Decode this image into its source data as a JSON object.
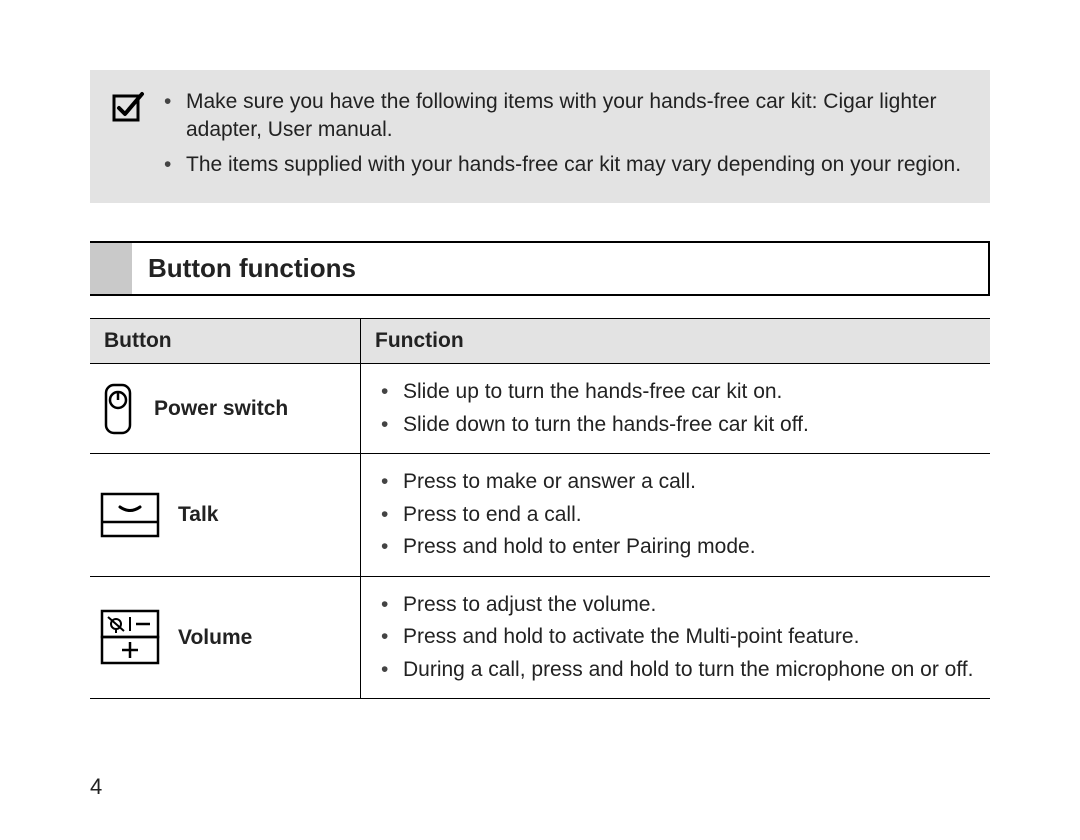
{
  "note": {
    "items": [
      "Make sure you have the following items with your hands-free car kit: Cigar lighter adapter, User manual.",
      "The items supplied with your hands-free car kit may vary depending on your region."
    ]
  },
  "section": {
    "title": "Button functions"
  },
  "table": {
    "headers": {
      "button": "Button",
      "function": "Function"
    },
    "rows": [
      {
        "label": "Power switch",
        "functions": [
          "Slide up to turn the hands-free car kit on.",
          "Slide down to turn the hands-free car kit off."
        ]
      },
      {
        "label": "Talk",
        "functions": [
          "Press to make or answer a call.",
          "Press to end a call.",
          "Press and hold to enter Pairing mode."
        ]
      },
      {
        "label": "Volume",
        "functions": [
          "Press to adjust the volume.",
          "Press and hold to activate the Multi-point feature.",
          "During a call, press and hold to turn the microphone on or off."
        ]
      }
    ]
  },
  "page_number": "4"
}
